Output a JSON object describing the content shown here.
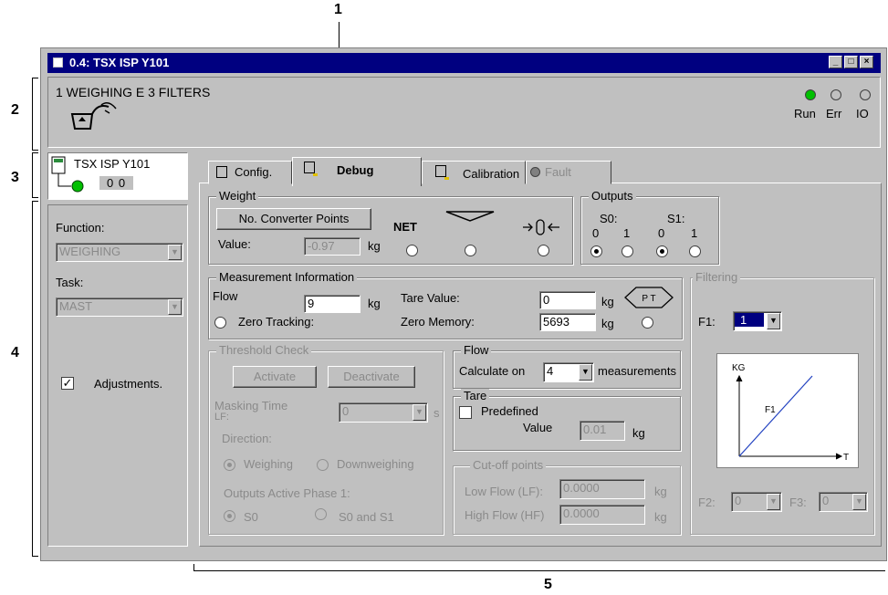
{
  "callouts": {
    "c1": "1",
    "c2": "2",
    "c3": "3",
    "c4": "4",
    "c5": "5"
  },
  "window": {
    "title": "0.4: TSX ISP Y101"
  },
  "header": {
    "title": "1 WEIGHING E 3 FILTERS",
    "status": [
      {
        "label": "Run",
        "state": "on"
      },
      {
        "label": "Err",
        "state": "off"
      },
      {
        "label": "IO",
        "state": "off"
      }
    ]
  },
  "module": {
    "name": "TSX ISP Y101",
    "address": "0 0"
  },
  "left": {
    "function_label": "Function:",
    "function_value": "WEIGHING",
    "task_label": "Task:",
    "task_value": "MAST",
    "adjustments_label": "Adjustments.",
    "adjustments_checked": true
  },
  "tabs": [
    {
      "label": "Config.",
      "active": false
    },
    {
      "label": "Debug",
      "active": true
    },
    {
      "label": "Calibration",
      "active": false
    },
    {
      "label": "Fault",
      "active": false
    }
  ],
  "weight": {
    "legend": "Weight",
    "button": "No. Converter Points",
    "net": "NET",
    "value_label": "Value:",
    "value": "-0.97",
    "unit": "kg"
  },
  "outputs": {
    "legend": "Outputs",
    "s0": "S0:",
    "s1": "S1:",
    "zero": "0",
    "one": "1"
  },
  "measurement": {
    "legend": "Measurement Information",
    "flow_label": "Flow",
    "flow_value": "9",
    "unit": "kg",
    "tare_label": "Tare Value:",
    "tare_value": "0",
    "zero_tracking": "Zero Tracking:",
    "zero_memory_label": "Zero Memory:",
    "zero_memory_value": "5693",
    "tare_icon": "P T"
  },
  "threshold": {
    "legend": "Threshold Check",
    "activate": "Activate",
    "deactivate": "Deactivate",
    "masking_label_1": "Masking Time",
    "masking_label_2": "LF:",
    "masking_value": "0",
    "masking_unit": "s",
    "direction": "Direction:",
    "weighing": "Weighing",
    "downweighing": "Downweighing",
    "outputs_phase": "Outputs Active Phase 1:",
    "s0": "S0",
    "s0s1": "S0 and S1"
  },
  "flow": {
    "legend": "Flow",
    "calc_label": "Calculate on",
    "calc_value": "4",
    "measurements": "measurements"
  },
  "tare": {
    "legend": "Tare",
    "predefined": "Predefined",
    "value_label": "Value",
    "value": "0.01",
    "unit": "kg"
  },
  "cutoff": {
    "legend": "Cut-off points",
    "low_label": "Low Flow (LF):",
    "low_value": "0.0000",
    "high_label": "High Flow (HF)",
    "high_value": "0.0000",
    "unit": "kg"
  },
  "filtering": {
    "legend": "Filtering",
    "f1_label": "F1:",
    "f1_value": "1",
    "graph_y": "KG",
    "graph_x": "T",
    "graph_line": "F1",
    "f2_label": "F2:",
    "f2_value": "0",
    "f3_label": "F3:",
    "f3_value": "0"
  },
  "colors": {
    "title_bar": "#000080",
    "run_led": "#00c000",
    "window_bg": "#c0c0c0",
    "graph_line": "#2040c0"
  }
}
